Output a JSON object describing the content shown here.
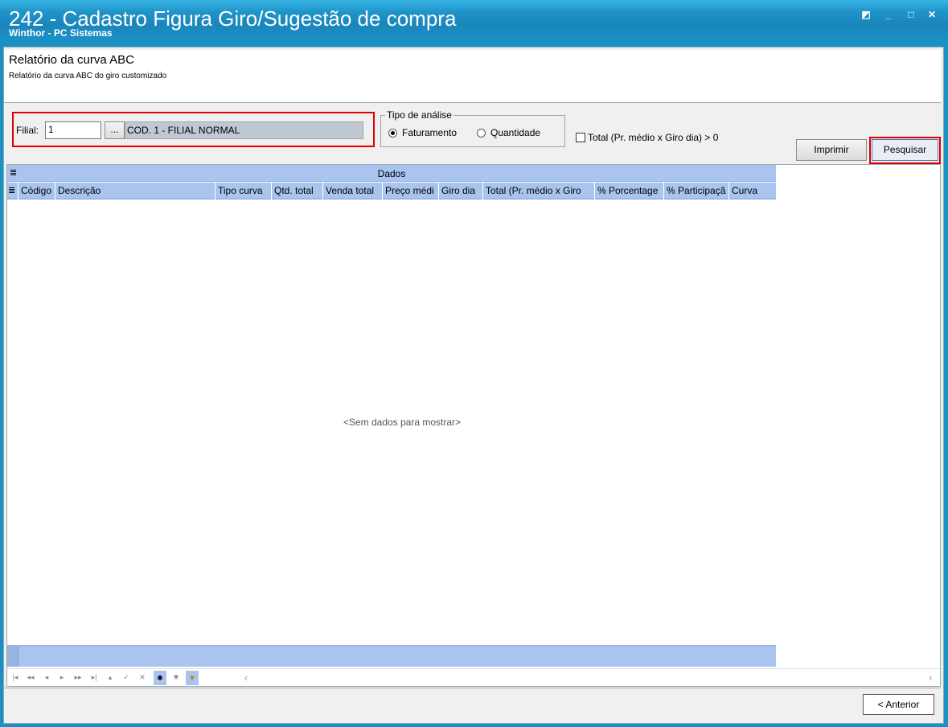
{
  "window": {
    "title": "242 - Cadastro Figura Giro/Sugestão de compra",
    "subtitle": "Winthor - PC Sistemas",
    "btn_restore": "◩",
    "btn_min": "_",
    "btn_max": "□",
    "btn_close": "✕"
  },
  "header": {
    "title": "Relatório da curva ABC",
    "subtitle": "Relatório da curva ABC do giro customizado"
  },
  "filter": {
    "filial_label": "Filial:",
    "filial_value": "1",
    "lookup_label": "...",
    "filial_name": "COD. 1 - FILIAL NORMAL"
  },
  "analysis": {
    "group_title": "Tipo de análise",
    "option_faturamento": "Faturamento",
    "option_quantidade": "Quantidade",
    "selected": "Faturamento"
  },
  "total_check_label": "Total (Pr. médio x Giro dia) > 0",
  "buttons": {
    "imprimir": "Imprimir",
    "pesquisar": "Pesquisar",
    "anterior": "< Anterior"
  },
  "grid": {
    "band_label": "Dados",
    "columns": [
      "Código",
      "Descrição",
      "Tipo curva",
      "Qtd. total",
      "Venda total",
      "Preço médi",
      "Giro dia",
      "Total (Pr. médio x Giro",
      "% Porcentage",
      "% Participaçã",
      "Curva"
    ],
    "empty_text": "<Sem dados para mostrar>"
  },
  "icons": {
    "grid_menu": "≣",
    "nav": [
      "|◂",
      "◂◂",
      "◂",
      "▸",
      "▸▸",
      "▸|",
      "▴",
      "✓",
      "✕",
      "✱",
      "✳",
      "▼"
    ],
    "scroll_left": "‹",
    "scroll_right": "›"
  },
  "colors": {
    "titlebar": "#1b90c5",
    "grid_header": "#a9c4ee",
    "highlight": "#e00000"
  }
}
